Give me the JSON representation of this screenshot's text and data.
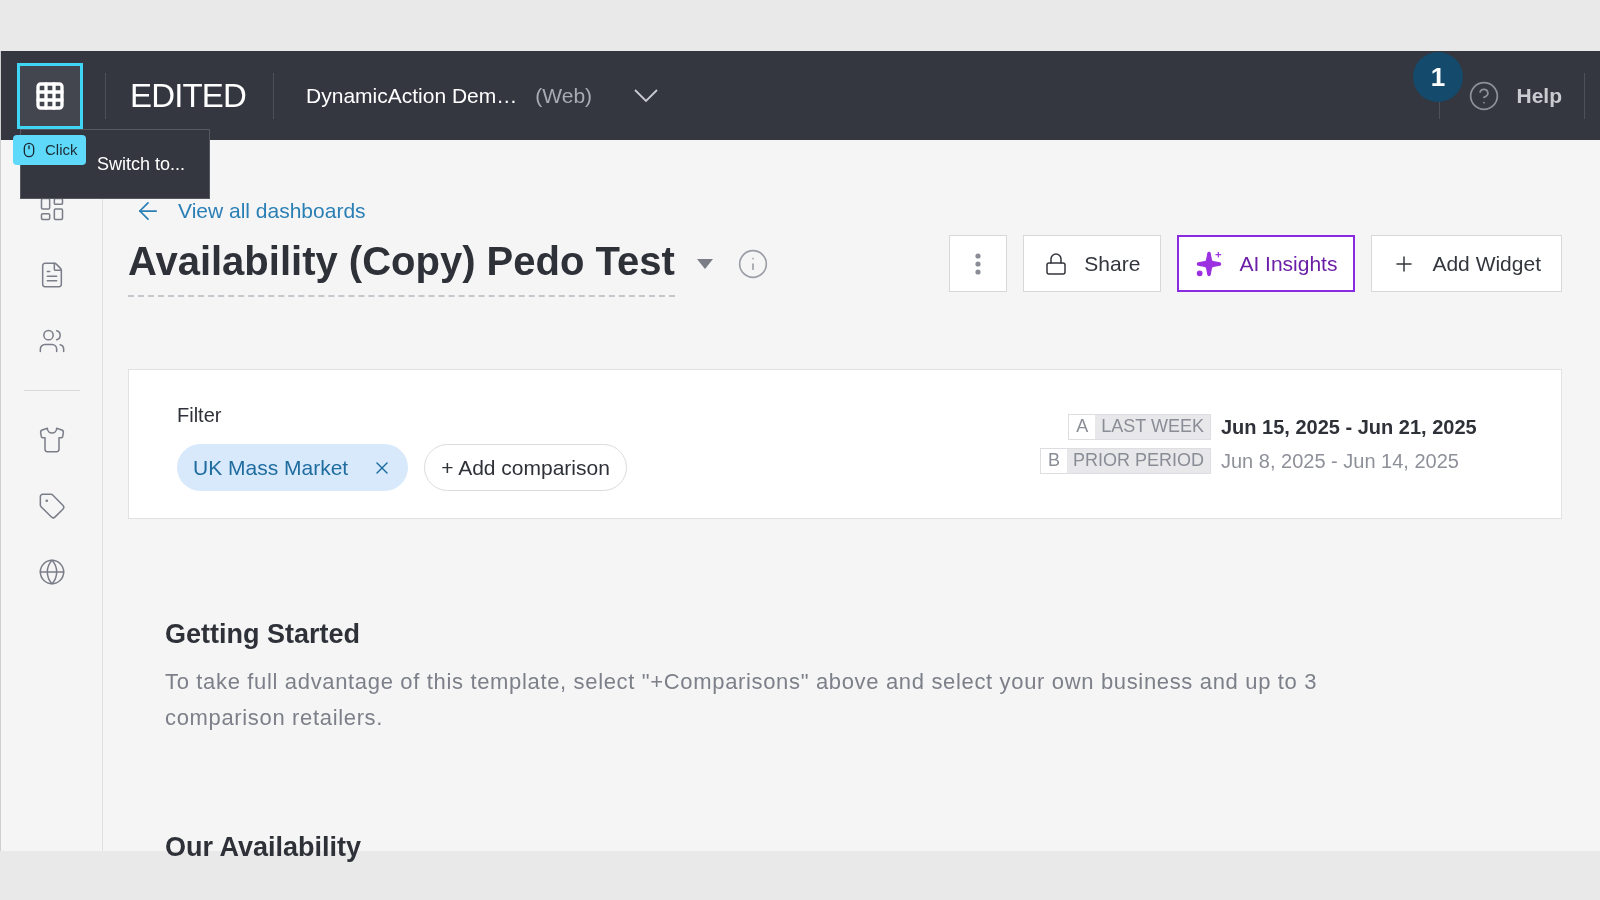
{
  "topbar": {
    "brand": "EDITED",
    "workspace": "DynamicAction Dem…",
    "platform": "(Web)",
    "help": "Help",
    "step_badge": "1"
  },
  "tooltip": {
    "text": "Switch to...",
    "click_badge": "Click"
  },
  "sidebar": {
    "items": [
      {
        "kind": "dashboard"
      },
      {
        "kind": "report"
      },
      {
        "kind": "people"
      },
      {
        "kind": "divider"
      },
      {
        "kind": "clothes"
      },
      {
        "kind": "tag"
      },
      {
        "kind": "globe"
      }
    ]
  },
  "back_link": "View all dashboards",
  "title": "Availability (Copy) Pedo Test",
  "actions": [
    {
      "kind": "more"
    },
    {
      "kind": "share",
      "label": "Share"
    },
    {
      "kind": "ai",
      "label": "AI Insights"
    },
    {
      "kind": "add",
      "label": "Add Widget"
    }
  ],
  "filter": {
    "label": "Filter",
    "chips": [
      {
        "label": "UK Mass Market"
      }
    ],
    "add_label": "+ Add comparison",
    "periods": [
      {
        "letter": "A",
        "name": "LAST WEEK",
        "range": "Jun 15, 2025 - Jun 21, 2025",
        "primary": true
      },
      {
        "letter": "B",
        "name": "PRIOR PERIOD",
        "range": "Jun 8, 2025 - Jun 14, 2025",
        "primary": false
      }
    ]
  },
  "getting_started": {
    "heading": "Getting Started",
    "text": "To take full advantage of this template, select \"+Comparisons\" above and select your own business and up to 3 comparison retailers."
  },
  "section_heading": "Our Availability"
}
